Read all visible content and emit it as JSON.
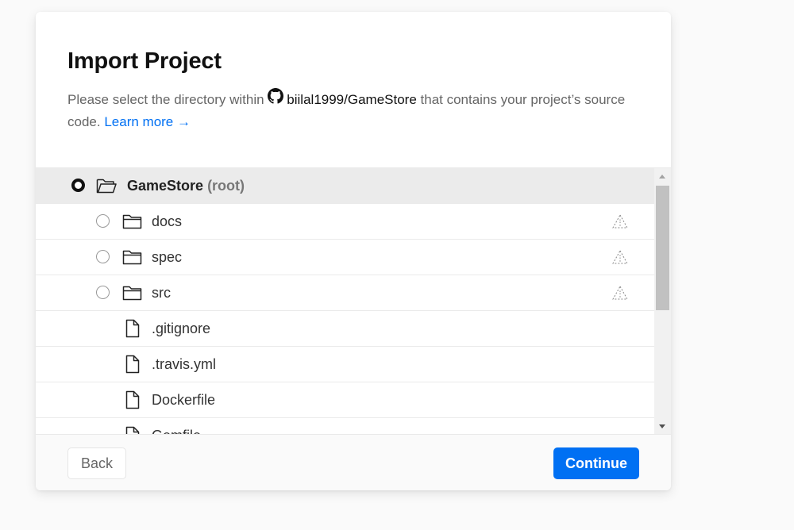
{
  "dialog": {
    "title": "Import Project",
    "description_before": "Please select the directory within",
    "repo_name": "biilal1999/GameStore",
    "description_after": "that contains your project’s source code.",
    "learn_more": "Learn more →"
  },
  "tree": {
    "root": {
      "name": "GameStore",
      "suffix": "(root)",
      "selected": true
    },
    "folders": [
      {
        "name": "docs",
        "icon": "folder-icon",
        "warning_icon": "warning-icon"
      },
      {
        "name": "spec",
        "icon": "folder-icon",
        "warning_icon": "warning-icon"
      },
      {
        "name": "src",
        "icon": "folder-icon",
        "warning_icon": "warning-icon"
      }
    ],
    "files": [
      {
        "name": ".gitignore",
        "icon": "file-icon"
      },
      {
        "name": ".travis.yml",
        "icon": "file-icon"
      },
      {
        "name": "Dockerfile",
        "icon": "file-icon"
      },
      {
        "name": "Gemfile",
        "icon": "file-icon"
      }
    ]
  },
  "footer": {
    "back_label": "Back",
    "continue_label": "Continue"
  },
  "colors": {
    "accent": "#0070f3",
    "selected_row": "#ebebeb",
    "border": "#eaeaea"
  }
}
